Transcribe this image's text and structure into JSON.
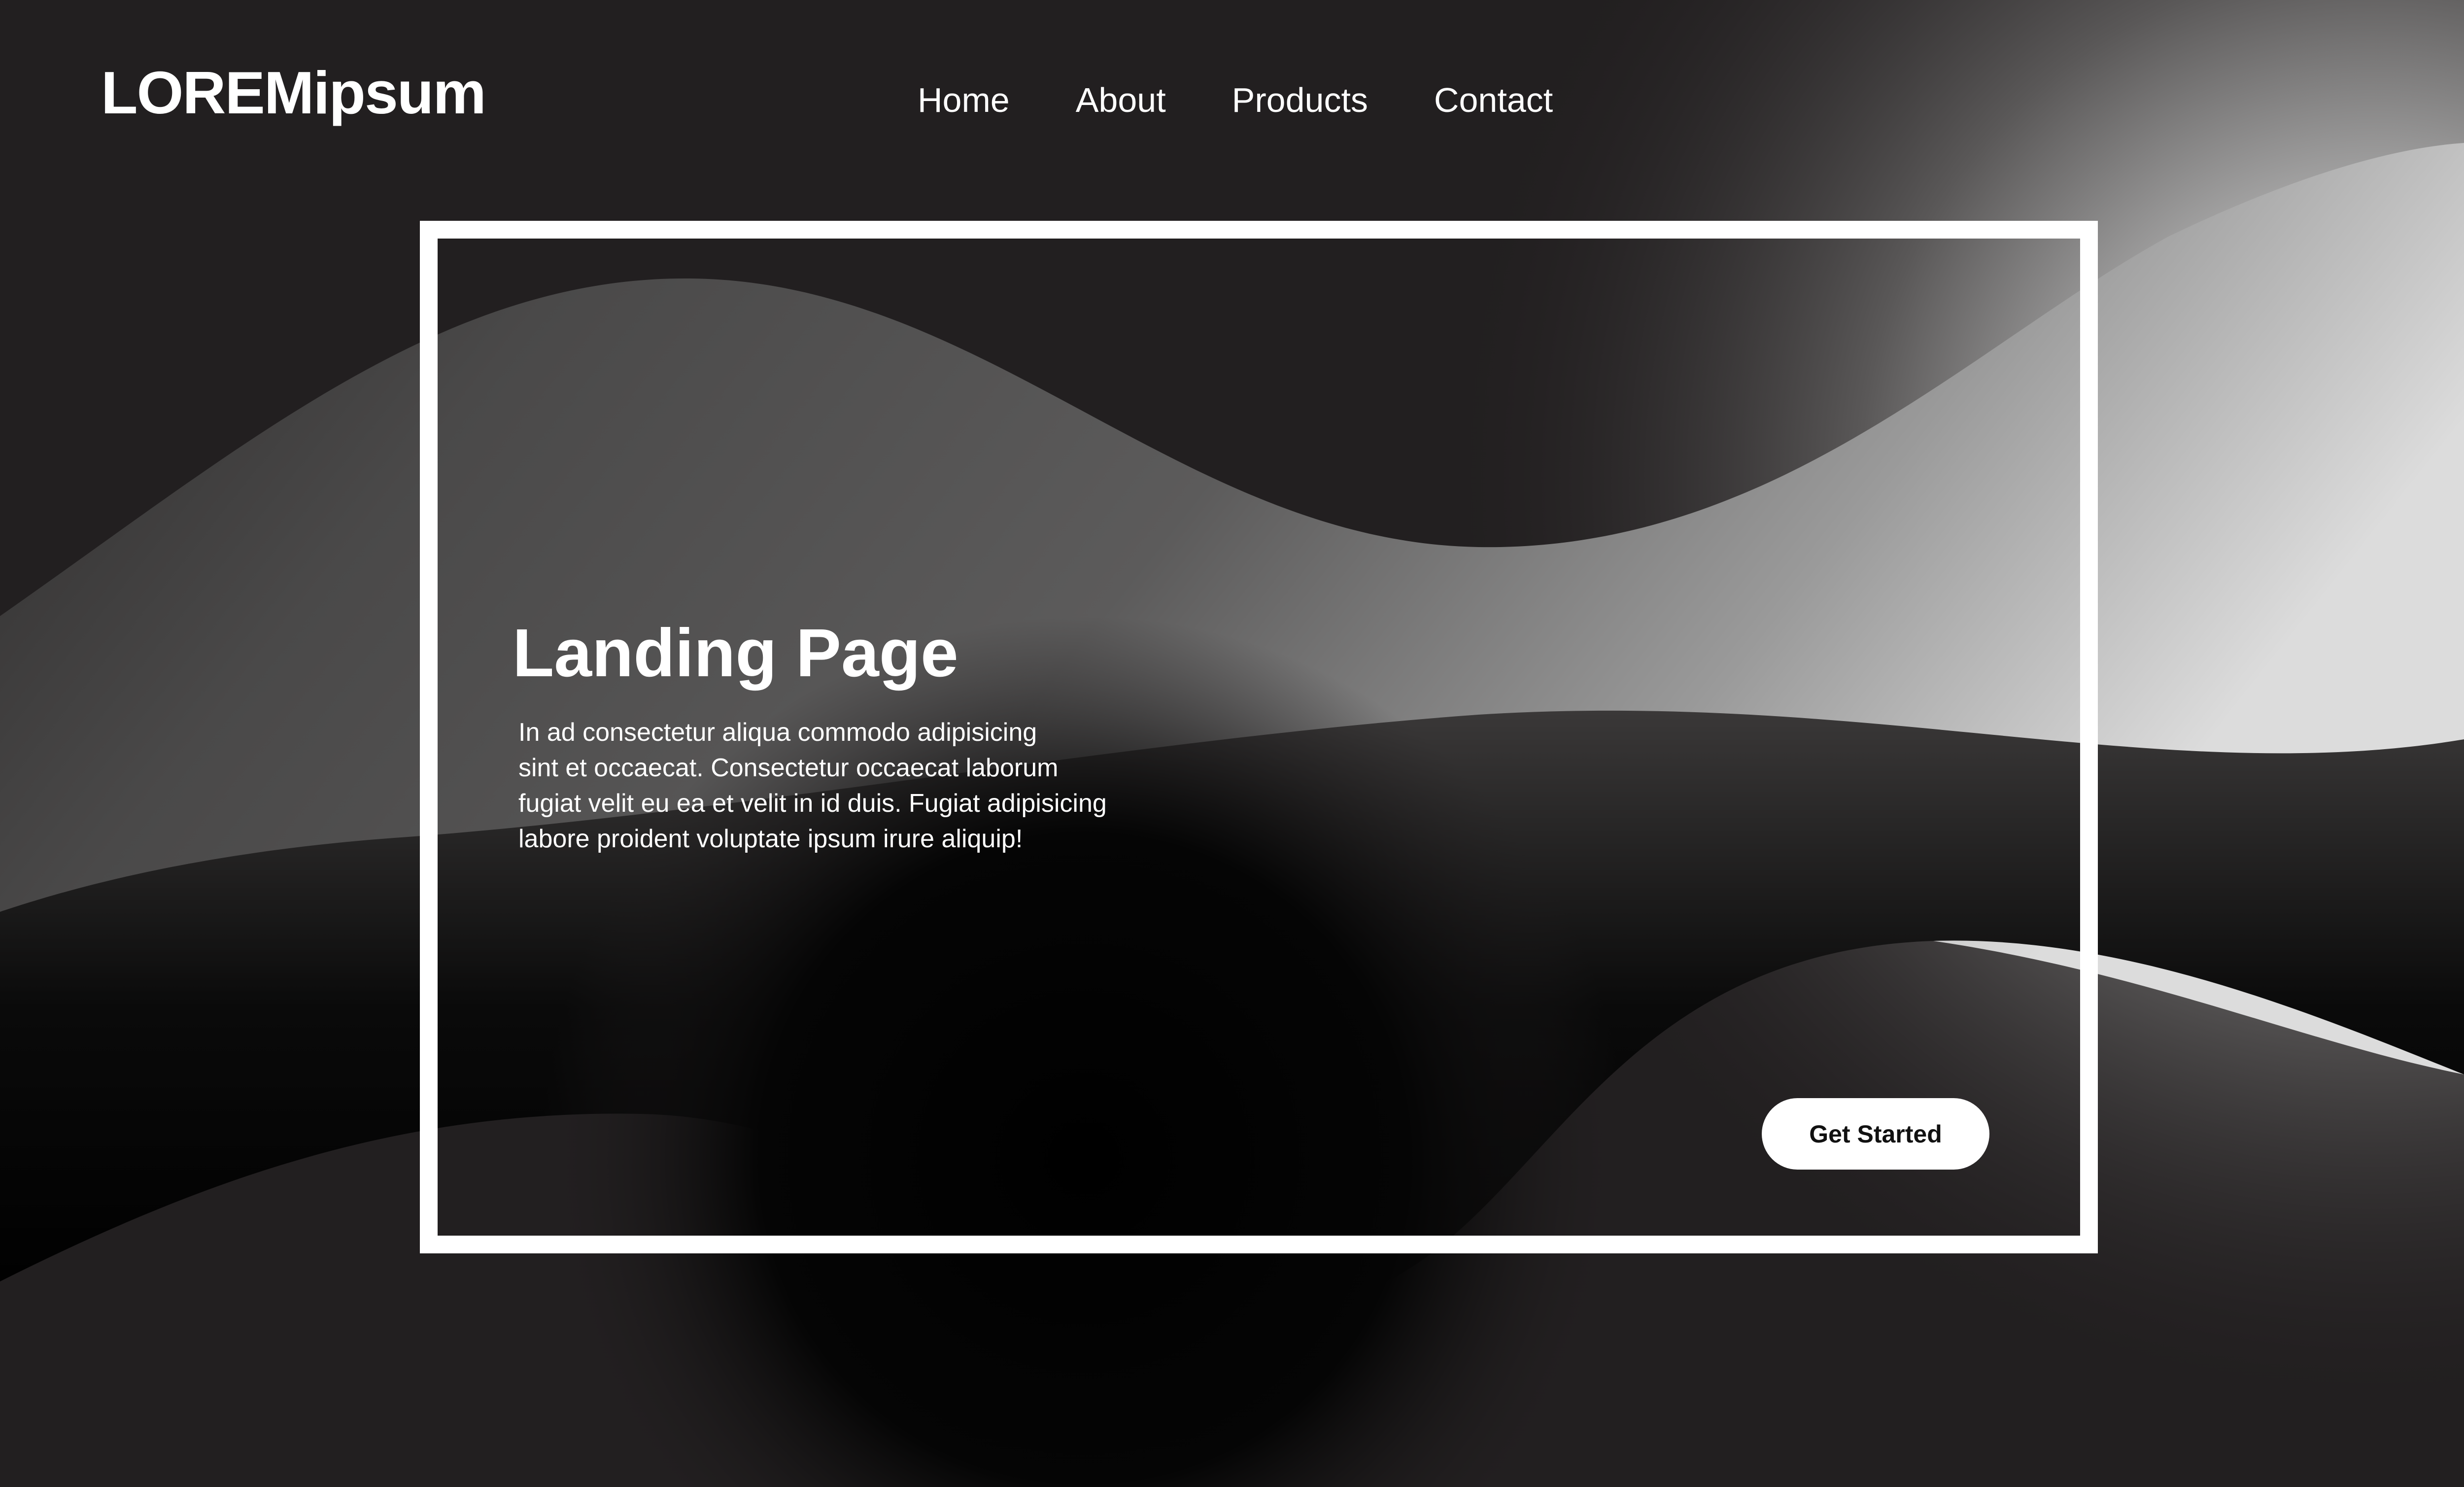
{
  "header": {
    "logo": "LOREMipsum",
    "nav": [
      "Home",
      "About",
      "Products",
      "Contact"
    ]
  },
  "hero": {
    "title": "Landing Page",
    "body_lines": [
      "In ad consectetur aliqua commodo adipisicing",
      "sint et occaecat. Consectetur occaecat laborum",
      "fugiat velit eu ea et velit in id duis. Fugiat adipisicing",
      "labore proident voluptate ipsum irure aliquip!"
    ],
    "cta_label": "Get Started"
  },
  "colors": {
    "background": "#221f20",
    "text": "#ffffff",
    "button_bg": "#ffffff",
    "button_text": "#111111"
  }
}
